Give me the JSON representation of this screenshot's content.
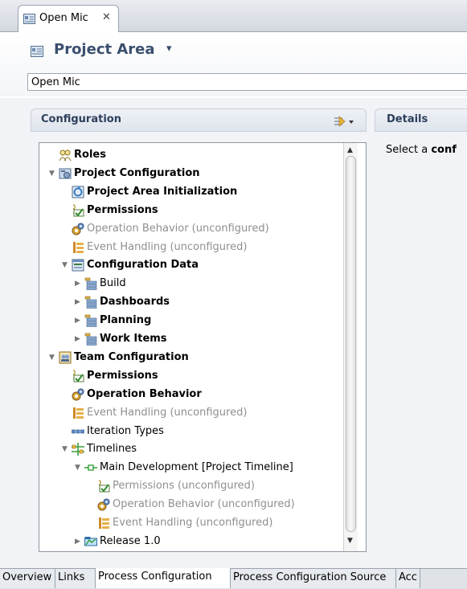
{
  "editor_tab": {
    "label": "Open Mic",
    "close": "✕"
  },
  "header": {
    "title": "Project Area",
    "caret": "▾",
    "name_value": "Open Mic"
  },
  "configuration": {
    "title": "Configuration",
    "tree": [
      {
        "label": "Roles",
        "bold": true,
        "gray": false,
        "icon": "roles-icon",
        "twisty": ""
      },
      {
        "label": "Project Configuration",
        "bold": true,
        "gray": false,
        "icon": "project-config-icon",
        "twisty": "▼"
      },
      {
        "label": "Project Area Initialization",
        "bold": true,
        "gray": false,
        "icon": "initialization-icon",
        "twisty": ""
      },
      {
        "label": "Permissions",
        "bold": true,
        "gray": false,
        "icon": "permissions-icon",
        "twisty": ""
      },
      {
        "label": "Operation Behavior (unconfigured)",
        "bold": false,
        "gray": true,
        "icon": "operation-behavior-icon",
        "twisty": ""
      },
      {
        "label": "Event Handling (unconfigured)",
        "bold": false,
        "gray": true,
        "icon": "event-handling-icon",
        "twisty": ""
      },
      {
        "label": "Configuration Data",
        "bold": true,
        "gray": false,
        "icon": "configuration-data-icon",
        "twisty": "▼"
      },
      {
        "label": "Build",
        "bold": false,
        "gray": false,
        "icon": "data-category-icon",
        "twisty": "▶"
      },
      {
        "label": "Dashboards",
        "bold": true,
        "gray": false,
        "icon": "data-category-icon",
        "twisty": "▶"
      },
      {
        "label": "Planning",
        "bold": true,
        "gray": false,
        "icon": "data-category-icon",
        "twisty": "▶"
      },
      {
        "label": "Work Items",
        "bold": true,
        "gray": false,
        "icon": "data-category-icon",
        "twisty": "▶"
      },
      {
        "label": "Team Configuration",
        "bold": true,
        "gray": false,
        "icon": "team-config-icon",
        "twisty": "▼"
      },
      {
        "label": "Permissions",
        "bold": true,
        "gray": false,
        "icon": "permissions-icon",
        "twisty": ""
      },
      {
        "label": "Operation Behavior",
        "bold": true,
        "gray": false,
        "icon": "operation-behavior-icon",
        "twisty": ""
      },
      {
        "label": "Event Handling (unconfigured)",
        "bold": false,
        "gray": true,
        "icon": "event-handling-icon",
        "twisty": ""
      },
      {
        "label": "Iteration Types",
        "bold": false,
        "gray": false,
        "icon": "iteration-types-icon",
        "twisty": ""
      },
      {
        "label": "Timelines",
        "bold": false,
        "gray": false,
        "icon": "timelines-icon",
        "twisty": "▼"
      },
      {
        "label": "Main Development [Project Timeline]",
        "bold": false,
        "gray": false,
        "icon": "timeline-icon",
        "twisty": "▼"
      },
      {
        "label": "Permissions (unconfigured)",
        "bold": false,
        "gray": true,
        "icon": "permissions-icon",
        "twisty": ""
      },
      {
        "label": "Operation Behavior (unconfigured)",
        "bold": false,
        "gray": true,
        "icon": "operation-behavior-icon",
        "twisty": ""
      },
      {
        "label": "Event Handling (unconfigured)",
        "bold": false,
        "gray": true,
        "icon": "event-handling-icon",
        "twisty": ""
      },
      {
        "label": "Release 1.0",
        "bold": false,
        "gray": false,
        "icon": "release-icon",
        "twisty": "▶"
      }
    ]
  },
  "details": {
    "title": "Details",
    "text_prefix": "Select a ",
    "text_bold": "conf"
  },
  "bottom_tabs": [
    "Overview",
    "Links",
    "Process Configuration",
    "Process Configuration Source",
    "Acc"
  ],
  "active_bottom_tab": "Process Configuration"
}
